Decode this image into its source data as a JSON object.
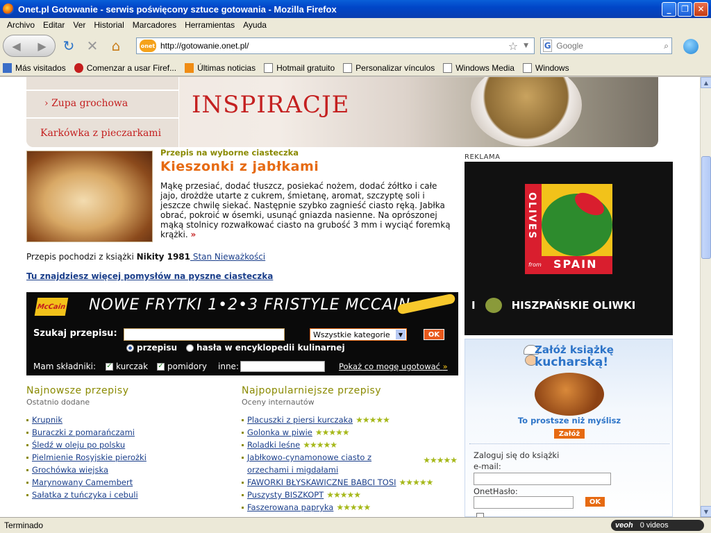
{
  "window": {
    "title": "Onet.pl Gotowanie - serwis poświęcony sztuce gotowania - Mozilla Firefox",
    "minimize": "_",
    "maximize": "❐",
    "close": "✕"
  },
  "menu": [
    "Archivo",
    "Editar",
    "Ver",
    "Historial",
    "Marcadores",
    "Herramientas",
    "Ayuda"
  ],
  "nav": {
    "site_badge": "onet",
    "url": "http://gotowanie.onet.pl/",
    "search_engine": "G",
    "search_placeholder": "Google"
  },
  "bookmarks": [
    "Más visitados",
    "Comenzar a usar Firef...",
    "Últimas noticias",
    "Hotmail gratuito",
    "Personalizar vínculos",
    "Windows Media",
    "Windows"
  ],
  "hero": {
    "side_items": [
      "Zupa grochowa",
      "Karkówka z pieczarkami"
    ],
    "headline": "INSPIRACJE"
  },
  "recipe": {
    "kicker": "Przepis na wyborne ciasteczka",
    "title": "Kieszonki z jabłkami",
    "text": "Mąkę przesiać, dodać tłuszcz, posiekać nożem, dodać żółtko i całe jajo, drożdże utarte z cukrem, śmietanę, aromat, szczyptę soli i jeszcze chwilę siekać. Następnie szybko zagnieść ciasto ręką. Jabłka obrać, pokroić w ósemki, usunąć gniazda nasienne. Na oprószonej mąką stolnicy rozwałkować ciasto na grubość 3 mm i wyciąć foremką krążki.",
    "more": "»",
    "source_prefix": "Przepis pochodzi z książki ",
    "source_author": "Nikity 1981",
    "source_link": " Stan Nieważkości",
    "more_link": "Tu znajdziesz więcej pomysłów na pyszne ciasteczka"
  },
  "search_panel": {
    "logo": "McCain",
    "headline": "NOWE FRYTKI 1•2•3 FRISTYLE MCCAIN",
    "label": "Szukaj przepisu:",
    "category": "Wszystkie kategorie",
    "ok": "OK",
    "radio_recipe": "przepisu",
    "radio_encyclopedia": "hasła w encyklopedii kulinarnej",
    "ingredients_label": "Mam składniki:",
    "ingredient_1": "kurczak",
    "ingredient_2": "pomidory",
    "other_label": "inne:",
    "show_link": "Pokaż co mogę ugotować",
    "show_arrows": "»"
  },
  "newest": {
    "heading": "Najnowsze przepisy",
    "subheading": "Ostatnio dodane",
    "items": [
      "Krupnik",
      "Buraczki z pomarańczami",
      "Śledź w oleju po polsku",
      "Pielmienie Rosyjskie pierożki",
      "Grochówka wiejska",
      "Marynowany Camembert",
      "Sałatka z tuńczyka i cebuli"
    ]
  },
  "popular": {
    "heading": "Najpopularniejsze przepisy",
    "subheading": "Oceny internautów",
    "stars": "★★★★★",
    "items": [
      "Placuszki z piersi kurczaka",
      "Golonka w piwie",
      "Roladki leśne",
      "Jabłkowo-cynamonowe ciasto z orzechami i migdałami",
      "FAWORKI BŁYSKAWICZNE BABCI TOSI",
      "Puszysty BISZKOPT",
      "Faszerowana papryka"
    ]
  },
  "ad": {
    "label": "REKLAMA",
    "olives": "OLIVES",
    "from": "from",
    "spain": "SPAIN",
    "bottom_i": "I",
    "bottom_text": "HISZPAŃSKIE OLIWKI"
  },
  "cookbook": {
    "title_line1": "Załóż książkę",
    "title_line2": "kucharską!",
    "tagline": "To prostsze niż myślisz",
    "button": "Załóż",
    "login_heading": "Zaloguj się do książki",
    "email_label": "e-mail:",
    "password_label": "OnetHasło:",
    "ok": "OK"
  },
  "status": {
    "text": "Terminado",
    "veoh": "veoh",
    "videos": "0  videos"
  }
}
